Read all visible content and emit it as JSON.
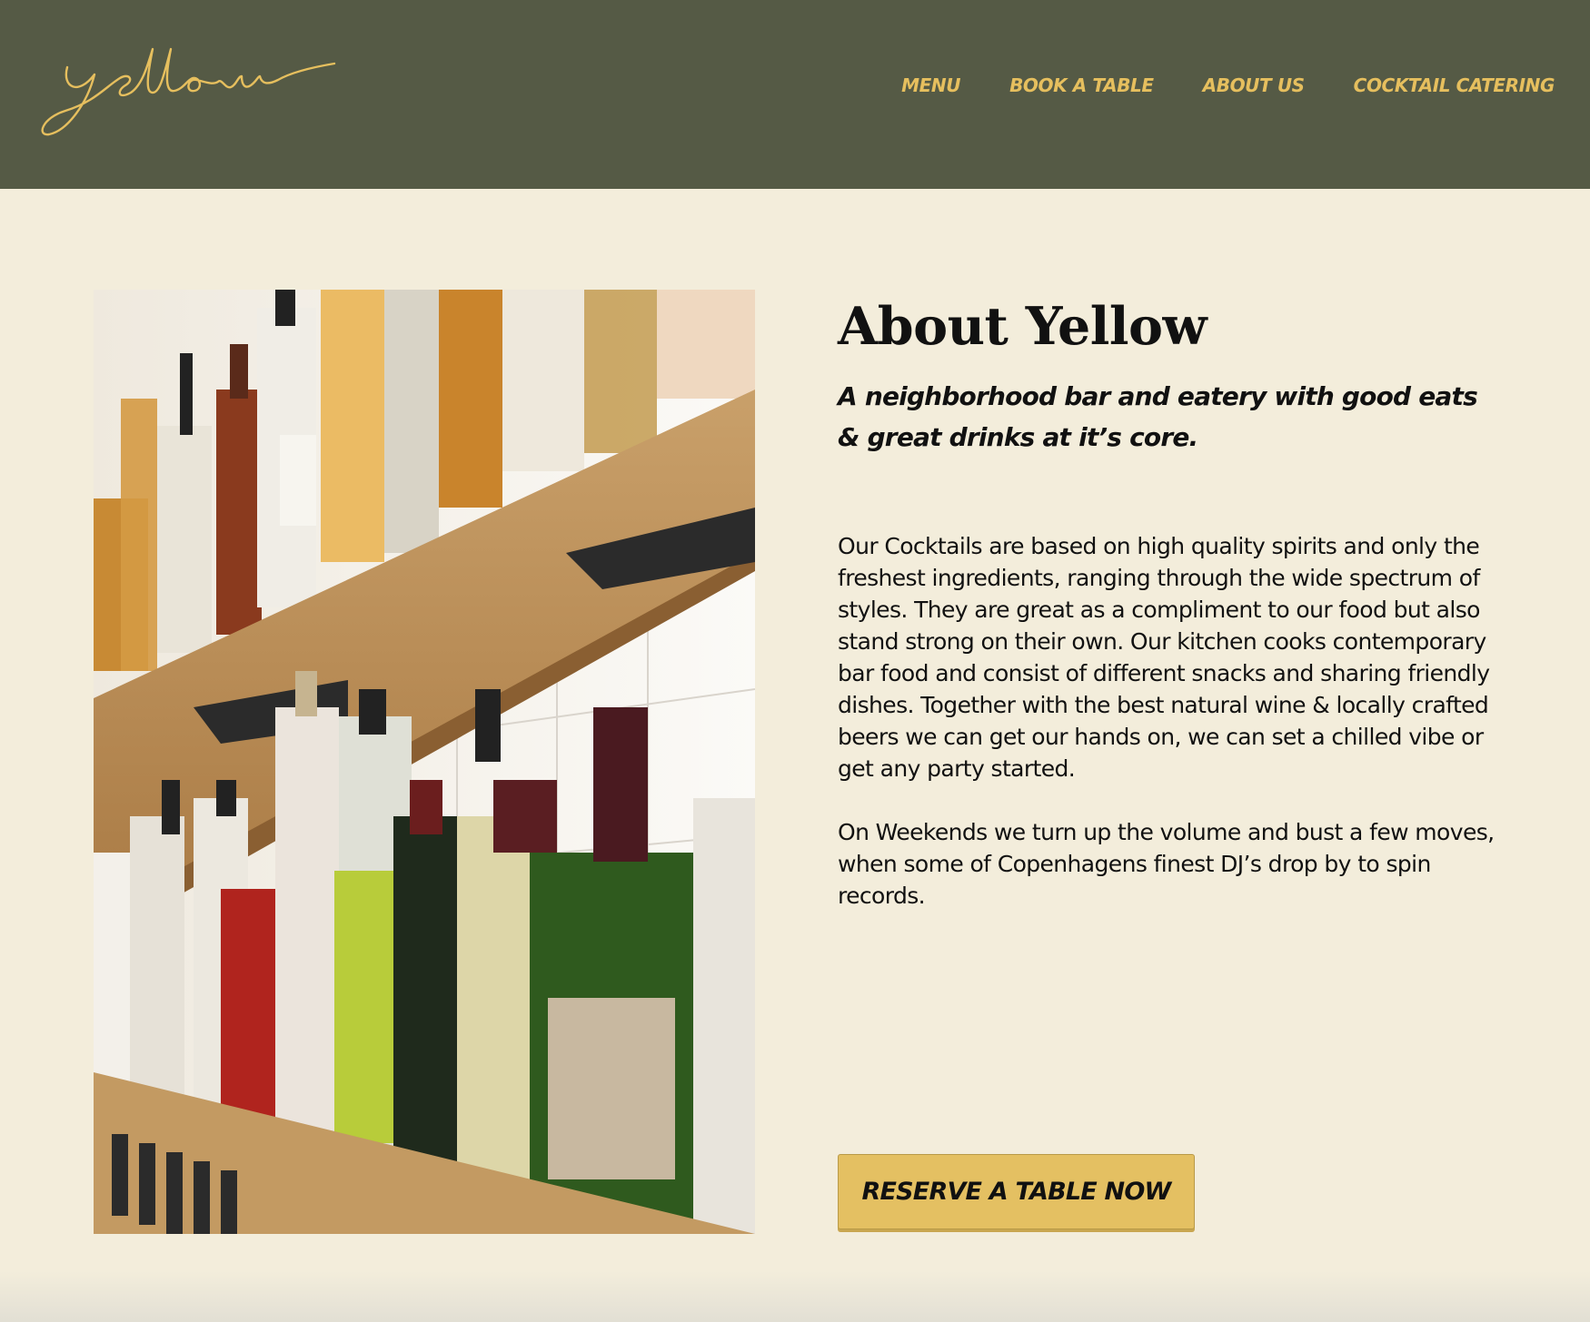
{
  "header": {
    "logo_text": "yellow",
    "nav": [
      {
        "label": "MENU"
      },
      {
        "label": "BOOK A TABLE"
      },
      {
        "label": "ABOUT US"
      },
      {
        "label": "COCKTAIL CATERING"
      }
    ]
  },
  "about": {
    "title": "About Yellow",
    "subtitle": "A neighborhood bar and eatery with good eats & great drinks at it’s core.",
    "paragraph_1": "Our Cocktails are based on high quality spirits and only the freshest ingredients, ranging through the wide spectrum of styles. They are great as a compliment to our food but also stand strong on their own. Our kitchen cooks contemporary bar food and consist of different snacks and sharing friendly dishes. Together with the best natural wine & locally crafted beers we can get our hands on, we can set a chilled vibe or get any party started.",
    "paragraph_2": "On Weekends we turn up the volume and bust a few moves, when some of Copenhagens finest DJ’s drop by to spin records.",
    "cta_label": "RESERVE A TABLE NOW"
  },
  "colors": {
    "header_bg": "#555a45",
    "accent_yellow": "#e6bf5e",
    "page_bg": "#f3eddb",
    "button_bg": "#e4c062"
  }
}
